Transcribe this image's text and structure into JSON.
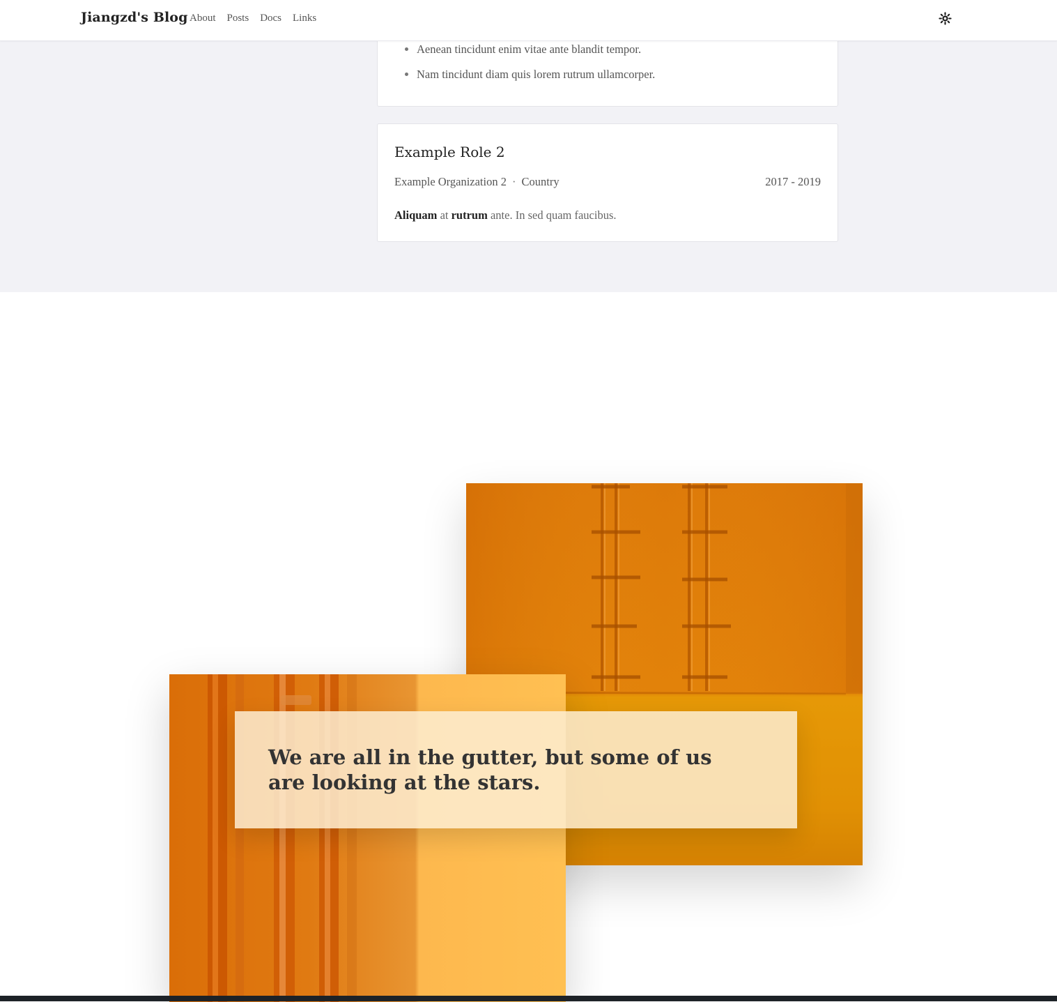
{
  "nav": {
    "brand": "Jiangzd's Blog",
    "links": [
      "About",
      "Posts",
      "Docs",
      "Links"
    ],
    "theme_toggle_icon": "sun-icon"
  },
  "experience": {
    "bullets": [
      "Aenean tincidunt enim vitae ante blandit tempor.",
      "Nam tincidunt diam quis lorem rutrum ullamcorper."
    ],
    "role2": {
      "title": "Example Role 2",
      "organization": "Example Organization 2",
      "separator": "·",
      "country": "Country",
      "dates": "2017 - 2019",
      "summary_bold_1": "Aliquam",
      "summary_text_1": " at ",
      "summary_bold_2": "rutrum",
      "summary_text_2": " ante. In sed quam faucibus."
    }
  },
  "quote": {
    "text": "We are all in the gutter, but some of us are looking at the stars."
  },
  "colors": {
    "section_bg": "#f2f2f6",
    "accent_orange": "#e2820a",
    "quote_box": "#fdedd2"
  }
}
